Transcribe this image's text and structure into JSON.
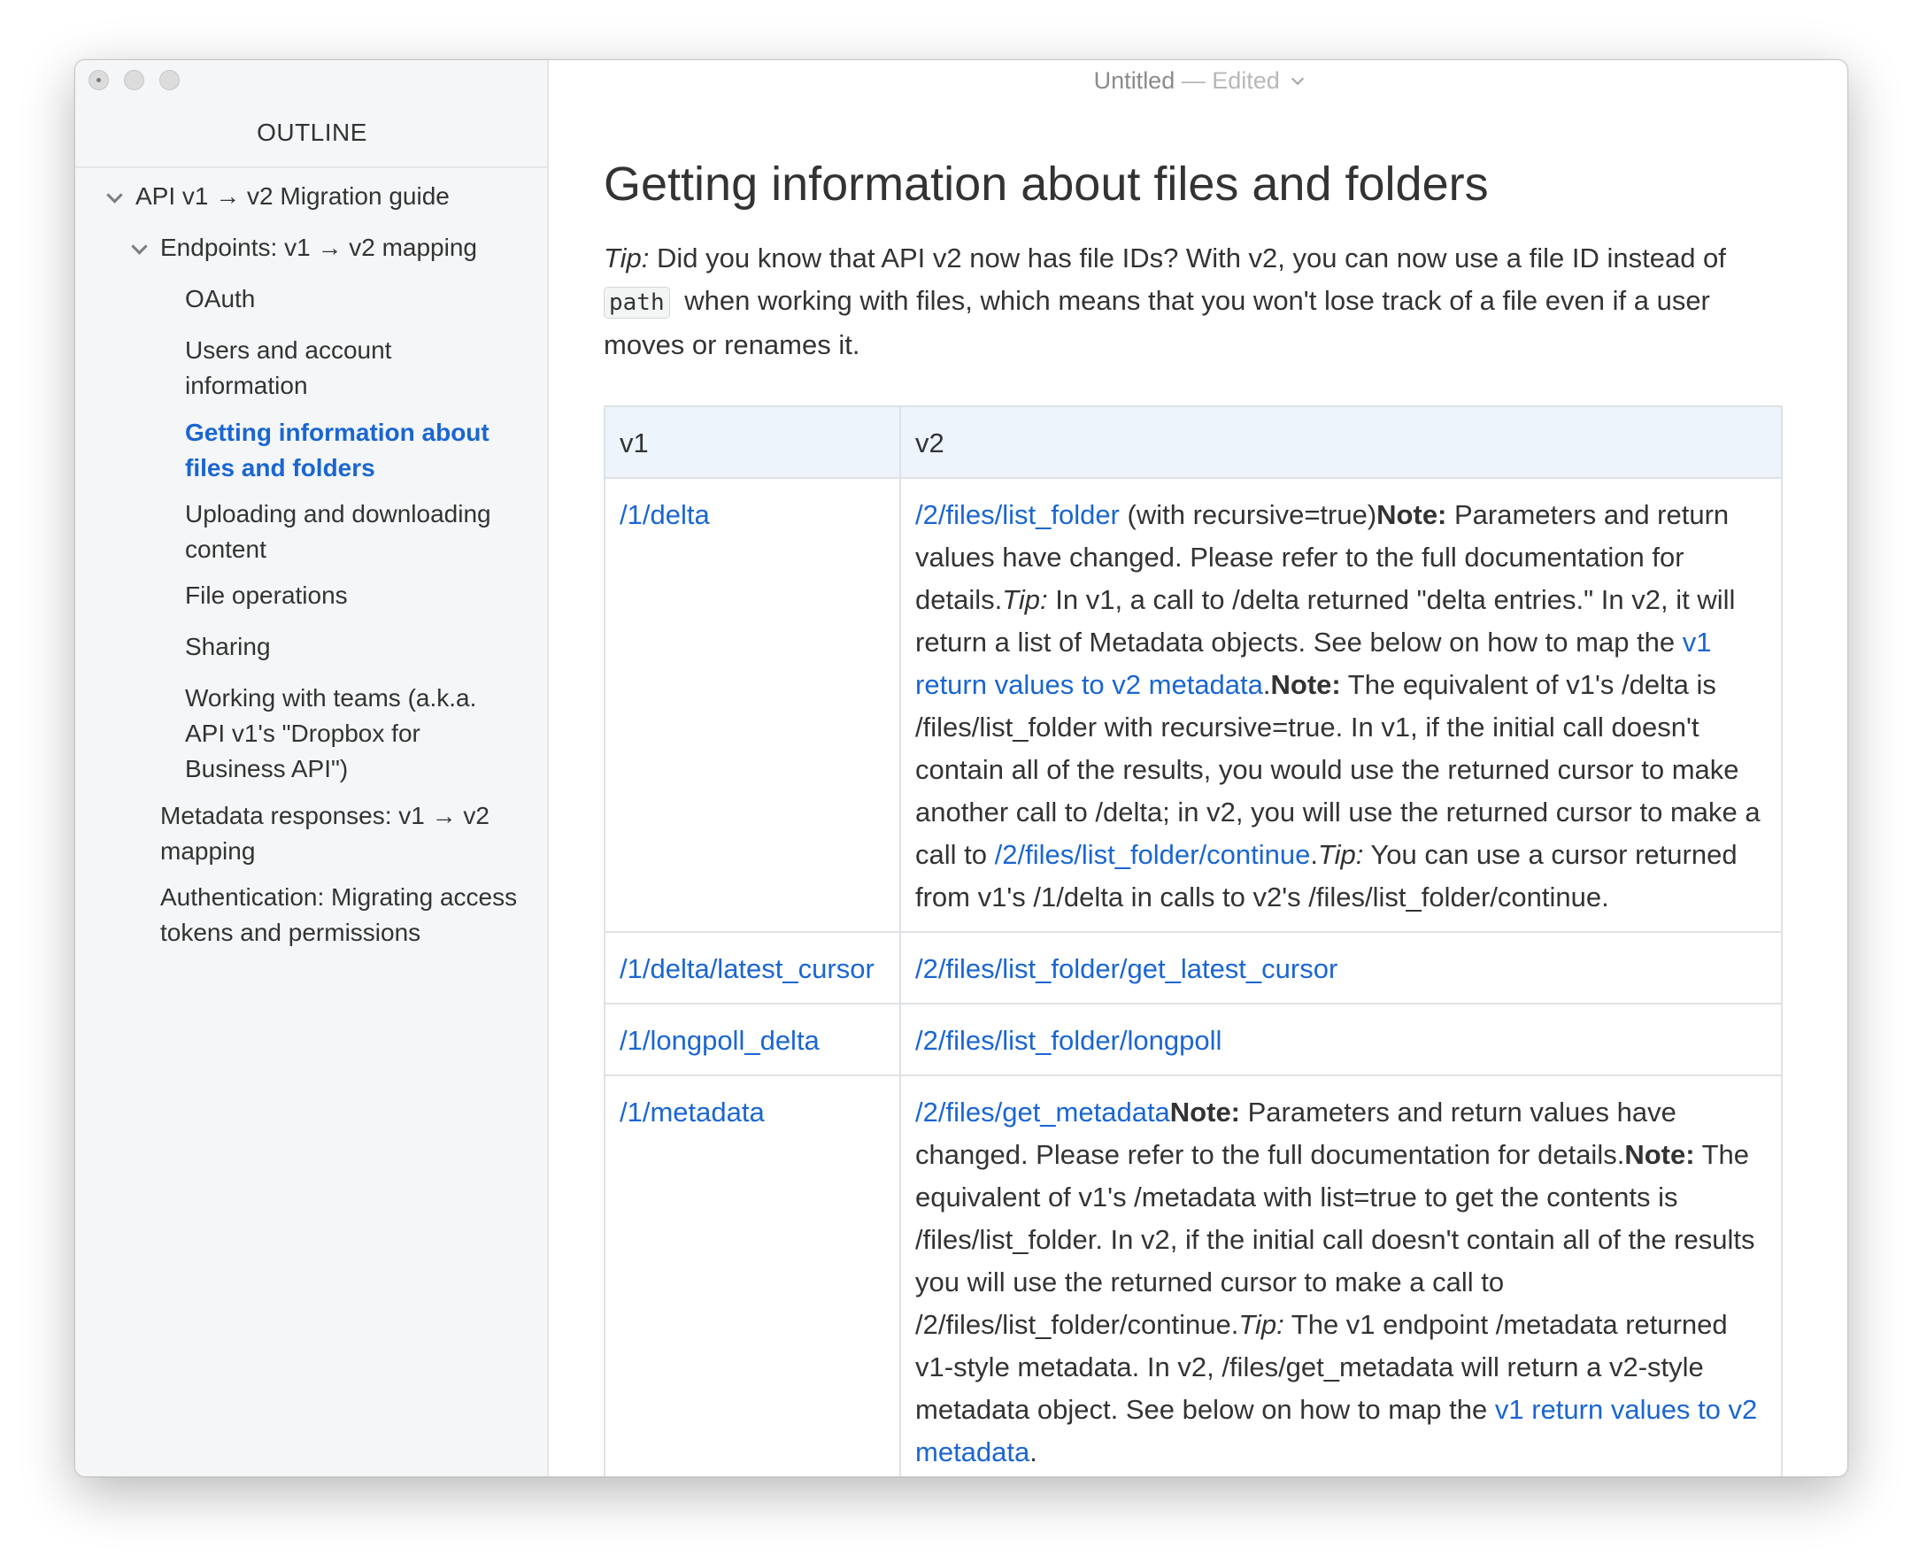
{
  "window": {
    "title": "Untitled",
    "status": "— Edited"
  },
  "sidebar": {
    "heading": "OUTLINE",
    "items": [
      {
        "label": "API v1 → v2 Migration guide"
      },
      {
        "label": "Endpoints: v1 → v2 mapping"
      },
      {
        "label": "OAuth"
      },
      {
        "label": "Users and account information"
      },
      {
        "label": "Getting information about files and folders"
      },
      {
        "label": "Uploading and downloading content"
      },
      {
        "label": "File operations"
      },
      {
        "label": "Sharing"
      },
      {
        "label": "Working with teams (a.k.a. API v1's \"Dropbox for Business API\")"
      },
      {
        "label": "Metadata responses: v1 → v2 mapping"
      },
      {
        "label": "Authentication: Migrating access tokens and permissions"
      }
    ]
  },
  "doc": {
    "heading": "Getting information about files and folders",
    "tip": {
      "label": "Tip:",
      "text_before": " Did you know that API v2 now has file IDs? With v2, you can now use a file ID instead of ",
      "code": "path",
      "text_after": " when working with files, which means that you won't lose track of a file even if a user moves or renames it."
    },
    "table": {
      "headers": [
        "v1",
        "v2"
      ],
      "rows": [
        {
          "v1": "/1/delta",
          "v2": {
            "link1": "/2/files/list_folder",
            "t1": " (with recursive=true)",
            "note1": "Note:",
            "t2": " Parameters and return values have changed. Please refer to the full documentation for details.",
            "tip1": "Tip:",
            "t3": " In v1, a call to /delta returned \"delta entries.\" In v2, it will return a list of Metadata objects. See below on how to map the ",
            "link2": "v1 return values to v2 metadata",
            "t4": ".",
            "note2": "Note:",
            "t5": " The equivalent of v1's /delta is /files/list_folder with recursive=true. In v1, if the initial call doesn't contain all of the results, you would use the returned cursor to make another call to /delta; in v2, you will use the returned cursor to make a call to ",
            "link3": "/2/files/list_folder/continue",
            "t6": ".",
            "tip2": "Tip:",
            "t7": " You can use a cursor returned from v1's /1/delta in calls to v2's /files/list_folder/continue."
          }
        },
        {
          "v1": "/1/delta/latest_cursor",
          "v2": {
            "link1": "/2/files/list_folder/get_latest_cursor"
          }
        },
        {
          "v1": "/1/longpoll_delta",
          "v2": {
            "link1": "/2/files/list_folder/longpoll"
          }
        },
        {
          "v1": "/1/metadata",
          "v2": {
            "link1": "/2/files/get_metadata",
            "note1": "Note:",
            "t1": " Parameters and return values have changed. Please refer to the full documentation for details.",
            "note2": "Note:",
            "t2": " The equivalent of v1's /metadata with list=true to get the contents is /files/list_folder. In v2, if the initial call doesn't contain all of the results you will use the returned cursor to make a call to /2/files/list_folder/continue.",
            "tip1": "Tip:",
            "t3": " The v1 endpoint /metadata returned v1-style metadata. In v2, /files/get_metadata will return a v2-style metadata object. See below on how to map the ",
            "link2": "v1 return values to v2 metadata",
            "t4": "."
          }
        }
      ]
    }
  }
}
